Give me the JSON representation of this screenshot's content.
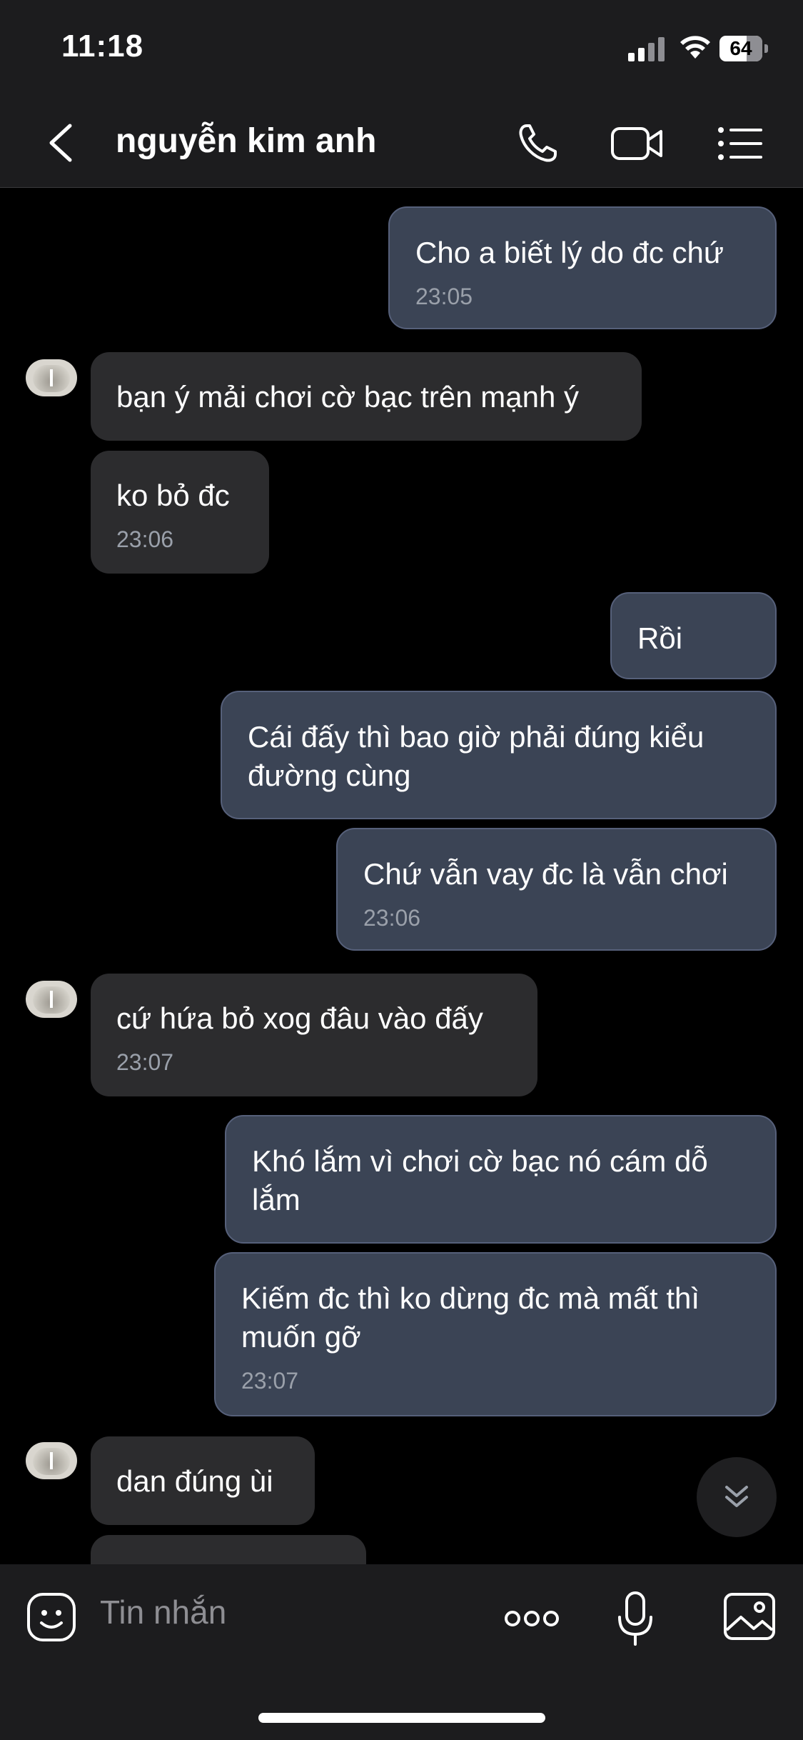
{
  "status_bar": {
    "time": "11:18",
    "battery": "64"
  },
  "header": {
    "title": "nguyễn kim anh"
  },
  "messages": [
    {
      "direction": "out",
      "text": "Cho a biết lý do đc chứ",
      "time": "23:05"
    },
    {
      "direction": "in",
      "text": "bạn ý mải chơi cờ bạc trên mạnh ý"
    },
    {
      "direction": "in",
      "text": "ko bỏ đc",
      "time": "23:06"
    },
    {
      "direction": "out",
      "text": "Rồi"
    },
    {
      "direction": "out",
      "text": "Cái đấy thì bao giờ phải đúng kiểu đường cùng"
    },
    {
      "direction": "out",
      "text": "Chứ vẫn vay đc là vẫn chơi",
      "time": "23:06"
    },
    {
      "direction": "in",
      "text": "cứ hứa bỏ xog đâu vào đấy",
      "time": "23:07"
    },
    {
      "direction": "out",
      "text": "Khó lắm vì chơi cờ bạc nó cám dỗ lắm"
    },
    {
      "direction": "out",
      "text": "Kiếm đc thì ko dừng đc mà mất thì muốn gỡ",
      "time": "23:07"
    },
    {
      "direction": "in",
      "text": "dan đúng ùi"
    }
  ],
  "composer": {
    "placeholder": "Tin nhắn"
  },
  "icons": {
    "back": "chevron-left-icon",
    "call": "phone-icon",
    "video": "video-camera-icon",
    "menu": "list-menu-icon",
    "sticker": "emoji-sticker-icon",
    "more": "more-dots-icon",
    "mic": "microphone-icon",
    "image": "image-icon",
    "scroll": "double-chevron-down-icon"
  },
  "colors": {
    "outgoing_bubble": "#3b4455",
    "incoming_bubble": "#2c2c2e",
    "bar": "#1c1c1e"
  }
}
